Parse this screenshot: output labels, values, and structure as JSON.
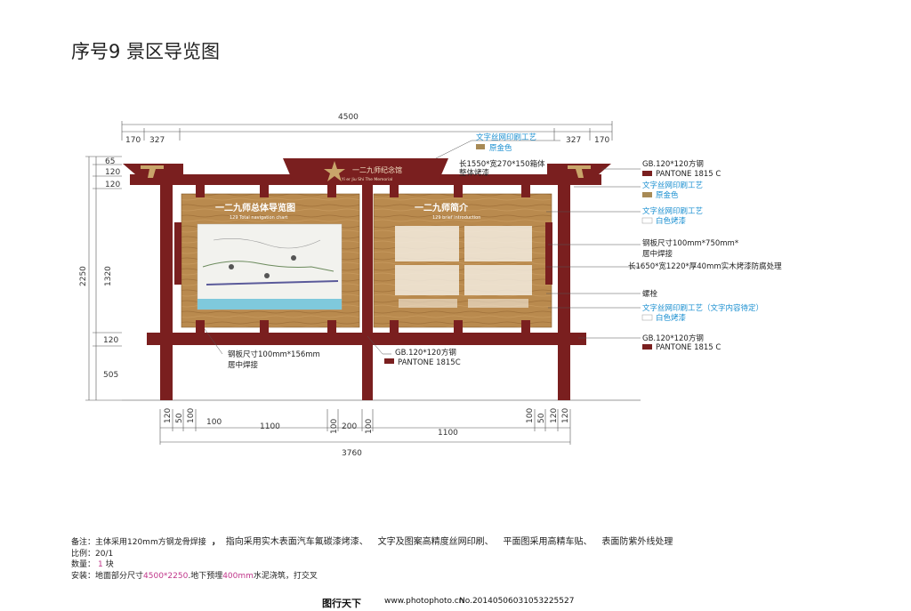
{
  "title": "序号9 景区导览图",
  "colors": {
    "frame": "#7a1f1f",
    "wood": "#b8874a",
    "blue_text": "#1a8fd0",
    "gold": "#a88a55",
    "magenta": "#c0368a"
  },
  "dims_top": {
    "total": "4500",
    "l1": "170",
    "l2": "327",
    "r2": "327",
    "r1": "170"
  },
  "dims_left": {
    "d65": "65",
    "d120a": "120",
    "d120b": "120",
    "d2250": "2250",
    "d1320": "1320",
    "d120c": "120",
    "d505": "505"
  },
  "dims_bottom": {
    "a": "120",
    "b": "50",
    "c": "100",
    "w1": "1100",
    "m1": "100",
    "m2": "200",
    "m3": "100",
    "w2": "1100",
    "d": "100",
    "e": "50",
    "f": "120",
    "total": "3760"
  },
  "sign": {
    "top_cn": "一二九师纪念馆",
    "top_en": "Yi er Jiu Shi The Memorial",
    "left_title": "一二九师总体导览图",
    "left_sub": "129 Total navigation chart",
    "right_title": "一二九师简介",
    "right_sub": "129 brief introduction"
  },
  "annotations": {
    "a_top_print": "文字丝网印刷工艺",
    "a_top_color": "原金色",
    "a_box": "长1550*宽270*150箱体",
    "a_box2": "整体烤漆",
    "r1_a": "GB.120*120方钢",
    "r1_b": "PANTONE 1815 C",
    "r2_a": "文字丝网印刷工艺",
    "r2_b": "原金色",
    "r3_a": "文字丝网印刷工艺",
    "r3_b": "白色烤漆",
    "r4_a": "钢板尺寸100mm*750mm*",
    "r4_b": "居中焊接",
    "r5": "长1650*宽1220*厚40mm实木烤漆防腐处理",
    "r6": "螺栓",
    "r7_a": "文字丝网印刷工艺（文字内容待定）",
    "r7_b": "白色烤漆",
    "r8_a": "GB.120*120方钢",
    "r8_b": "PANTONE 1815 C",
    "b1_a": "钢板尺寸100mm*156mm",
    "b1_b": "居中焊接",
    "b2_a": "GB.120*120方钢",
    "b2_b": "PANTONE 1815C"
  },
  "notes": {
    "n1_a": "备注：主体采用120mm方钢龙骨焊接",
    "n1_b": "，",
    "n1_c": "指向采用实木表面汽车氟碳漆烤漆、",
    "n1_d": "文字及图案高精度丝网印刷、",
    "n1_e": "平面图采用高精车贴、",
    "n1_f": "表面防紫外线处理",
    "n2": "比例：20/1",
    "n3_a": "数量：",
    "n3_b": "1",
    "n3_c": "块",
    "n4_a": "安装：地面部分尺寸",
    "n4_b": "4500*2250",
    "n4_c": ".地下预埋",
    "n4_d": "400mm",
    "n4_e": "水泥浇筑，打交叉"
  },
  "footer": {
    "logo": "图行天下",
    "url": "www.photophoto.cn",
    "no": "No.20140506031053225527"
  }
}
